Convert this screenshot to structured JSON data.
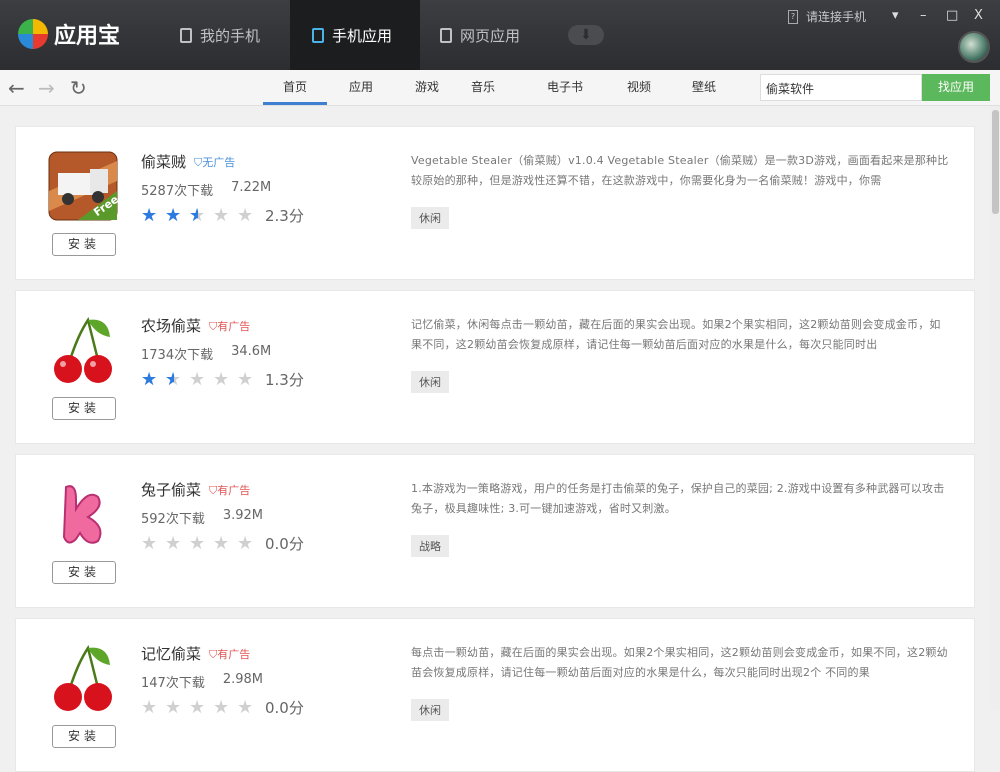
{
  "app": {
    "name": "应用宝"
  },
  "top_tabs": [
    {
      "label": "我的手机"
    },
    {
      "label": "手机应用"
    },
    {
      "label": "网页应用"
    }
  ],
  "connect": "请连接手机",
  "window": {
    "menu": "▾",
    "min": "–",
    "max": "□",
    "close": "X"
  },
  "nav": {
    "back": "←",
    "forward": "→",
    "refresh": "↻"
  },
  "categories": [
    "首页",
    "应用",
    "游戏",
    "音乐",
    "电子书",
    "视频",
    "壁纸"
  ],
  "search": {
    "value": "偷菜软件",
    "button": "找应用"
  },
  "install_label": "安装",
  "apps": [
    {
      "name": "偷菜贼",
      "ad": "无广告",
      "downloads": "5287次下载",
      "size": "7.22M",
      "rating": 2.5,
      "score": "2.3分",
      "desc": "Vegetable Stealer（偷菜贼）v1.0.4 Vegetable Stealer（偷菜贼）是一款3D游戏，画面看起来是那种比较原始的那种，但是游戏性还算不错，在这款游戏中，你需要化身为一名偷菜贼！游戏中，你需",
      "tag": "休闲"
    },
    {
      "name": "农场偷菜",
      "ad": "有广告",
      "downloads": "1734次下载",
      "size": "34.6M",
      "rating": 1.5,
      "score": "1.3分",
      "desc": "记忆偷菜，休闲每点击一颗幼苗，藏在后面的果实会出现。如果2个果实相同，这2颗幼苗则会变成金币，如果不同，这2颗幼苗会恢复成原样，请记住每一颗幼苗后面对应的水果是什么，每次只能同时出",
      "tag": "休闲"
    },
    {
      "name": "兔子偷菜",
      "ad": "有广告",
      "downloads": "592次下载",
      "size": "3.92M",
      "rating": 0,
      "score": "0.0分",
      "desc": "1.本游戏为一策略游戏，用户的任务是打击偷菜的兔子，保护自己的菜园; 2.游戏中设置有多种武器可以攻击兔子，极具趣味性; 3.可一键加速游戏，省时又刺激。",
      "tag": "战略"
    },
    {
      "name": "记忆偷菜",
      "ad": "有广告",
      "downloads": "147次下载",
      "size": "2.98M",
      "rating": 0,
      "score": "0.0分",
      "desc": "每点击一颗幼苗，藏在后面的果实会出现。如果2个果实相同，这2颗幼苗则会变成金币，如果不同，这2颗幼苗会恢复成原样，请记住每一颗幼苗后面对应的水果是什么，每次只能同时出现2个 不同的果",
      "tag": "休闲"
    }
  ]
}
